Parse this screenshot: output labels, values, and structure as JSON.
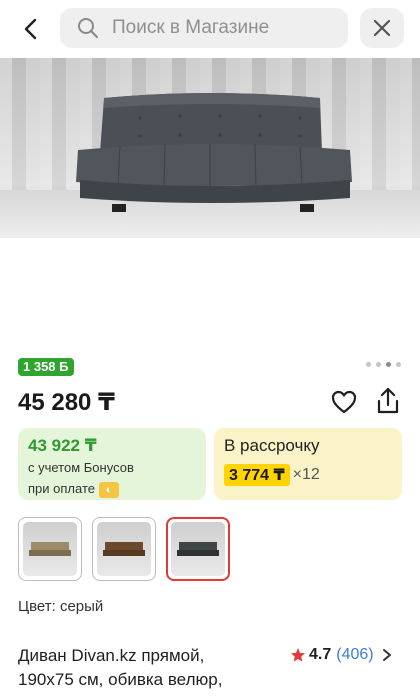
{
  "search": {
    "placeholder": "Поиск в Магазине"
  },
  "product": {
    "bonus_badge": "1 358 Б",
    "price": "45 280 ₸",
    "bonus_card": {
      "amount": "43 922 ₸",
      "line1": "с учетом Бонусов",
      "line2": "при оплате"
    },
    "installment_card": {
      "title": "В рассрочку",
      "monthly": "3 774 ₸",
      "multiplier": "×12"
    },
    "color_label": "Цвет: серый",
    "swatches": [
      {
        "name": "beige",
        "color": "#9c8a6a",
        "selected": false
      },
      {
        "name": "brown",
        "color": "#6b4a2e",
        "selected": false
      },
      {
        "name": "gray",
        "color": "#3f4447",
        "selected": true
      }
    ],
    "title_line1": "Диван Divan.kz прямой,",
    "title_line2": "190x75 см, обивка велюр,",
    "rating": {
      "value": "4.7",
      "count": "(406)"
    }
  },
  "icons": {
    "back": "chevron-left-icon",
    "search": "search-icon",
    "close": "close-icon",
    "favorite": "heart-icon",
    "share": "share-icon",
    "star": "star-icon"
  },
  "colors": {
    "bonus_green": "#2fa52f",
    "installment_yellow": "#ffd400",
    "selected_red": "#e53935",
    "link_blue": "#3d7bd9"
  }
}
